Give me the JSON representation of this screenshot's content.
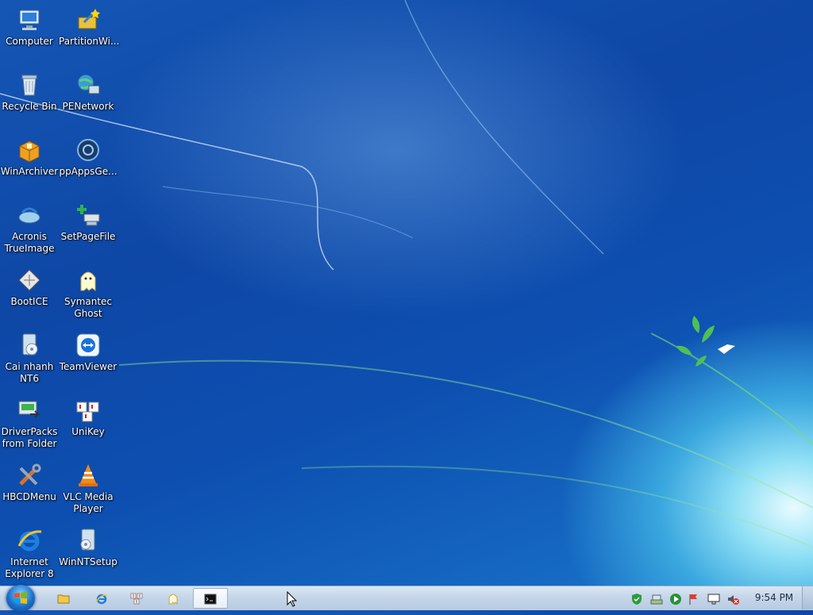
{
  "desktop": {
    "icons": [
      {
        "label": "Computer",
        "icon": "computer-icon"
      },
      {
        "label": "PartitionWi...",
        "icon": "partition-wizard-icon"
      },
      {
        "label": "Recycle Bin",
        "icon": "recycle-bin-icon"
      },
      {
        "label": "PENetwork",
        "icon": "network-globe-icon"
      },
      {
        "label": "WinArchiver",
        "icon": "archive-box-icon"
      },
      {
        "label": "ppAppsGe...",
        "icon": "ppapps-icon"
      },
      {
        "label": "Acronis TrueImage",
        "icon": "acronis-icon"
      },
      {
        "label": "SetPageFile",
        "icon": "setpagefile-icon"
      },
      {
        "label": "BootICE",
        "icon": "bootice-icon"
      },
      {
        "label": "Symantec Ghost",
        "icon": "ghost-icon"
      },
      {
        "label": "Cai nhanh NT6",
        "icon": "install-nt6-icon"
      },
      {
        "label": "TeamViewer",
        "icon": "teamviewer-icon"
      },
      {
        "label": "DriverPacks from Folder",
        "icon": "driverpacks-icon"
      },
      {
        "label": "UniKey",
        "icon": "unikey-icon"
      },
      {
        "label": "HBCDMenu",
        "icon": "tools-icon"
      },
      {
        "label": "VLC Media Player",
        "icon": "vlc-cone-icon"
      },
      {
        "label": "Internet Explorer 8",
        "icon": "internet-explorer-icon"
      },
      {
        "label": "WinNTSetup",
        "icon": "winntsetup-icon"
      }
    ]
  },
  "taskbar": {
    "pinned": [
      "file-explorer-icon",
      "internet-explorer-icon",
      "unikey-icon",
      "ghost-icon",
      "command-prompt-icon"
    ],
    "tray": [
      "security-shield-icon",
      "network-icon",
      "media-play-icon",
      "flag-icon",
      "display-icon",
      "volume-muted-icon"
    ],
    "clock": "9:54 PM"
  },
  "colors": {
    "desktop": "#0e47a6",
    "taskbar": "#c5d6e9"
  }
}
